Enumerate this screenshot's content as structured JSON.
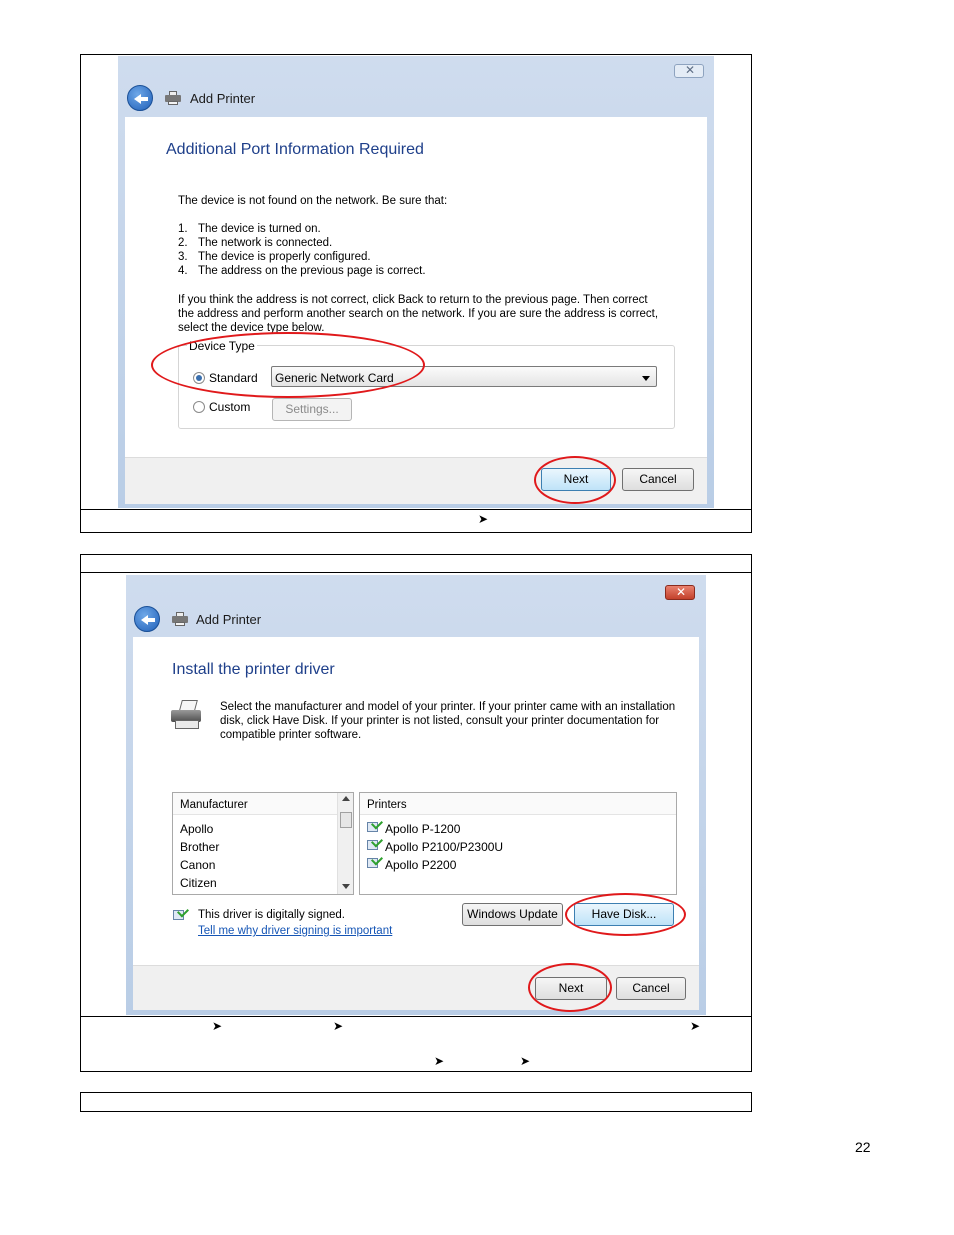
{
  "dialog1": {
    "title": "Add Printer",
    "heading": "Additional Port Information Required",
    "intro": "The device is not found on the network.  Be sure that:",
    "checklist": [
      {
        "num": "1.",
        "text": "The device is turned on."
      },
      {
        "num": "2.",
        "text": "The network is connected."
      },
      {
        "num": "3.",
        "text": "The device is properly configured."
      },
      {
        "num": "4.",
        "text": "The address on the previous page is correct."
      }
    ],
    "paragraph_lines": [
      "If you think the address is not correct, click Back to return to the previous page.  Then correct",
      "the address and perform another search on the network.  If you are sure the address is correct,",
      "select the device type below."
    ],
    "device_type_label": "Device Type",
    "standard_label": "Standard",
    "standard_value": "Generic Network Card",
    "custom_label": "Custom",
    "settings_label": "Settings...",
    "next_label": "Next",
    "cancel_label": "Cancel"
  },
  "dialog2": {
    "title": "Add Printer",
    "heading": "Install the printer driver",
    "description_lines": [
      "Select the manufacturer and model of your printer. If your printer came with an installation",
      "disk, click Have Disk. If your printer is not listed, consult your printer documentation for",
      "compatible printer software."
    ],
    "manufacturer_header": "Manufacturer",
    "manufacturers": [
      "Apollo",
      "Brother",
      "Canon",
      "Citizen"
    ],
    "printers_header": "Printers",
    "printers": [
      "Apollo P-1200",
      "Apollo P2100/P2300U",
      "Apollo P2200"
    ],
    "signed_text": "This driver is digitally signed.",
    "signing_link": "Tell me why driver signing is important",
    "windows_update_label": "Windows Update",
    "have_disk_label": "Have Disk...",
    "next_label": "Next",
    "cancel_label": "Cancel"
  },
  "page_number": "22",
  "colors": {
    "highlight_ring": "#e0191b",
    "heading_blue": "#1e3f8a",
    "link_blue": "#1555b5"
  }
}
